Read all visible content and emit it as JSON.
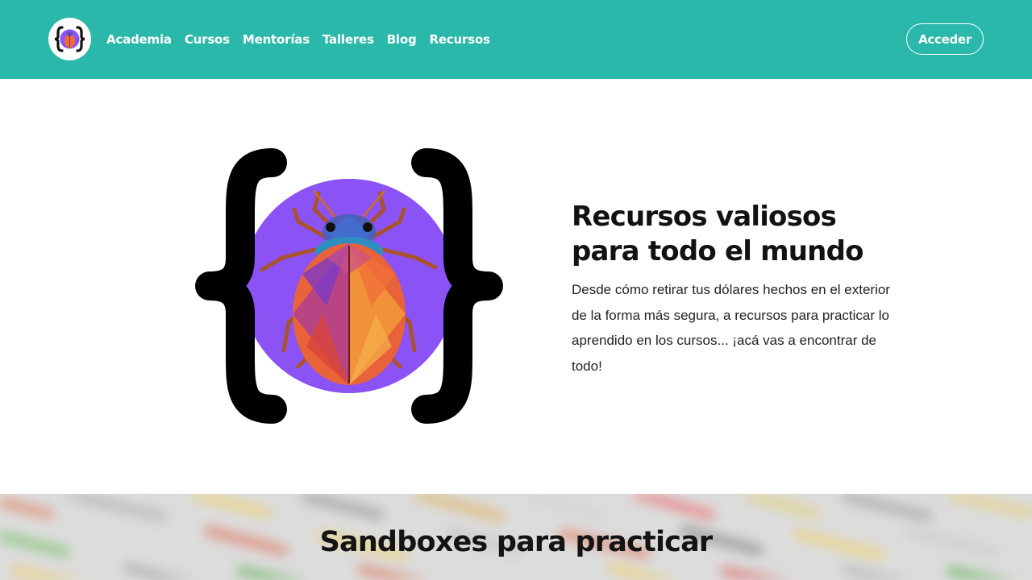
{
  "header": {
    "logo_alt": "logo",
    "nav": [
      {
        "label": "Academia"
      },
      {
        "label": "Cursos"
      },
      {
        "label": "Mentorías"
      },
      {
        "label": "Talleres"
      },
      {
        "label": "Blog"
      },
      {
        "label": "Recursos"
      }
    ],
    "login_label": "Acceder",
    "bg_color": "#2ab8ab"
  },
  "hero": {
    "title": "Recursos valiosos para todo el mundo",
    "description": "Desde cómo retirar tus dólares hechos en el exterior de la forma más segura, a recursos para practicar lo aprendido en los cursos... ¡acá vas a encontrar de todo!",
    "art_icon": "beetle-in-braces-icon",
    "circle_color": "#8b52f6"
  },
  "sandboxes": {
    "title": "Sandboxes para practicar"
  }
}
